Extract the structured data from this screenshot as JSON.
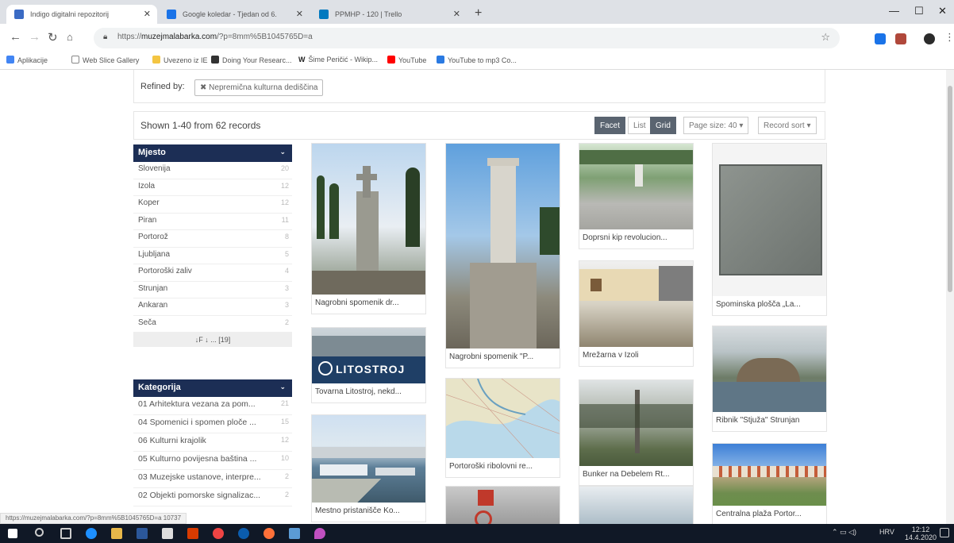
{
  "browser": {
    "tabs": [
      {
        "title": "Indigo digitalni repozitorij",
        "active": true,
        "color": "#3b6bc4"
      },
      {
        "title": "Google koledar - Tjedan od 6.",
        "active": false,
        "color": "#1a73e8"
      },
      {
        "title": "PPMHP - 120 | Trello",
        "active": false,
        "color": "#0079bf"
      }
    ],
    "url_host": "muzejmalabarka.com",
    "url_prefix": "https://",
    "url_path": "/?p=8mm%5B1045765D=a",
    "bookmarks": [
      {
        "label": "Aplikacije",
        "color": "#4285f4"
      },
      {
        "label": "Web Slice Gallery",
        "color": "#999999"
      },
      {
        "label": "Uvezeno iz IE",
        "color": "#f4c542"
      },
      {
        "label": "Doing Your Researc...",
        "color": "#333333"
      },
      {
        "label": "Šime Peričić - Wikip...",
        "color": "#ffffff"
      },
      {
        "label": "YouTube",
        "color": "#ff0000"
      },
      {
        "label": "YouTube to mp3 Co...",
        "color": "#2a7ae2"
      }
    ]
  },
  "refine": {
    "label": "Refined by:",
    "chip": "Nepremična kulturna dediščina"
  },
  "results": {
    "count": "Shown 1-40 from 62 records",
    "buttons": {
      "facet": "Facet",
      "list": "List",
      "grid": "Grid",
      "page_size": "Page size: 40",
      "sort": "Record sort"
    }
  },
  "facets": [
    {
      "title": "Mjesto",
      "items": [
        {
          "label": "Slovenija",
          "n": "20"
        },
        {
          "label": "Izola",
          "n": "12"
        },
        {
          "label": "Koper",
          "n": "12"
        },
        {
          "label": "Piran",
          "n": "11"
        },
        {
          "label": "Portorož",
          "n": "8"
        },
        {
          "label": "Ljubljana",
          "n": "5"
        },
        {
          "label": "Portoroški zaliv",
          "n": "4"
        },
        {
          "label": "Strunjan",
          "n": "3"
        },
        {
          "label": "Ankaran",
          "n": "3"
        },
        {
          "label": "Seča",
          "n": "2"
        }
      ],
      "controls": "↓F ↓ ... [19]"
    },
    {
      "title": "Kategorija",
      "items": [
        {
          "label": "01 Arhitektura vezana za pom...",
          "n": "21"
        },
        {
          "label": "04 Spomenici i spomen ploče ...",
          "n": "15"
        },
        {
          "label": "06 Kulturni krajolik",
          "n": "12"
        },
        {
          "label": "05 Kulturno povijesna baština ...",
          "n": "10"
        },
        {
          "label": "03 Muzejske ustanove, interpre...",
          "n": "2"
        },
        {
          "label": "02 Objekti pomorske signalizac...",
          "n": "2"
        }
      ]
    }
  ],
  "cards": [
    {
      "caption": "Nagrobni spomenik dr...",
      "scene": "cemetery-cross"
    },
    {
      "caption": "Tovarna Litostroj, nekd...",
      "scene": "litostroj"
    },
    {
      "caption": "Mestno pristanišče Ko...",
      "scene": "harbor"
    },
    {
      "caption": "Nagrobni spomenik \"P...",
      "scene": "pillar"
    },
    {
      "caption": "Portoroški ribolovni re...",
      "scene": "map"
    },
    {
      "caption": "",
      "scene": "sign"
    },
    {
      "caption": "Doprsni kip revolucion...",
      "scene": "bust"
    },
    {
      "caption": "Mrežarna v Izoli",
      "scene": "net-building"
    },
    {
      "caption": "Bunker na Debelem Rt...",
      "scene": "bunker"
    },
    {
      "caption": "",
      "scene": "sea"
    },
    {
      "caption": "Spominska plošča „La...",
      "scene": "plaque"
    },
    {
      "caption": "Ribnik \"Stjuža\" Strunjan",
      "scene": "pond"
    },
    {
      "caption": "Centralna plaža Portor...",
      "scene": "beach"
    }
  ],
  "litostroj_logo": "LITOSTROJ",
  "status_url": "https://muzejmalabarka.com/?p=8mm%5B1045765D=a 10737",
  "taskbar": {
    "time": "12:12",
    "date": "14.4.2020",
    "lang": "HRV"
  }
}
